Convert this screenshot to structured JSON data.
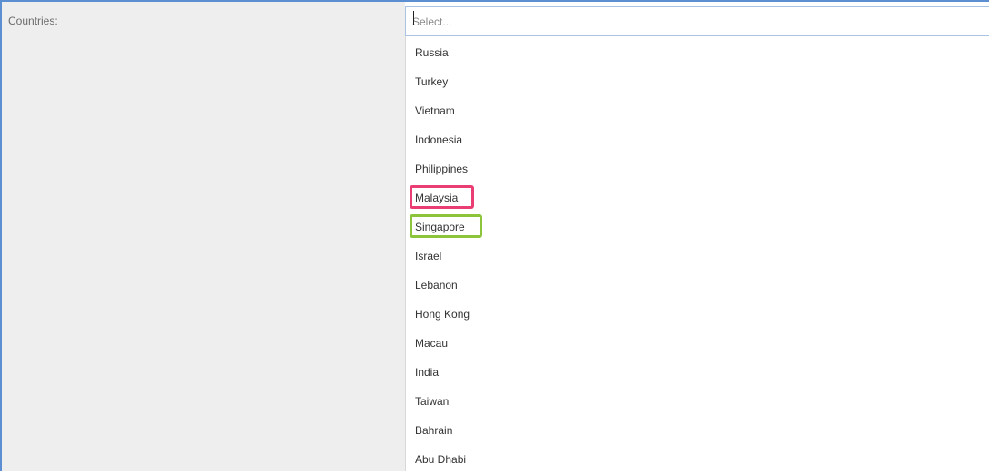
{
  "form": {
    "countries_label": "Countries:",
    "select_placeholder": "Select..."
  },
  "dropdown": {
    "options": [
      "Russia",
      "Turkey",
      "Vietnam",
      "Indonesia",
      "Philippines",
      "Malaysia",
      "Singapore",
      "Israel",
      "Lebanon",
      "Hong Kong",
      "Macau",
      "India",
      "Taiwan",
      "Bahrain",
      "Abu Dhabi"
    ],
    "highlights": {
      "Malaysia": "#ea3d73",
      "Singapore": "#8cc43c"
    }
  },
  "colors": {
    "frame_border": "#5b8fd1",
    "label_background": "#eeeeee",
    "select_border": "#a9c3e4"
  }
}
